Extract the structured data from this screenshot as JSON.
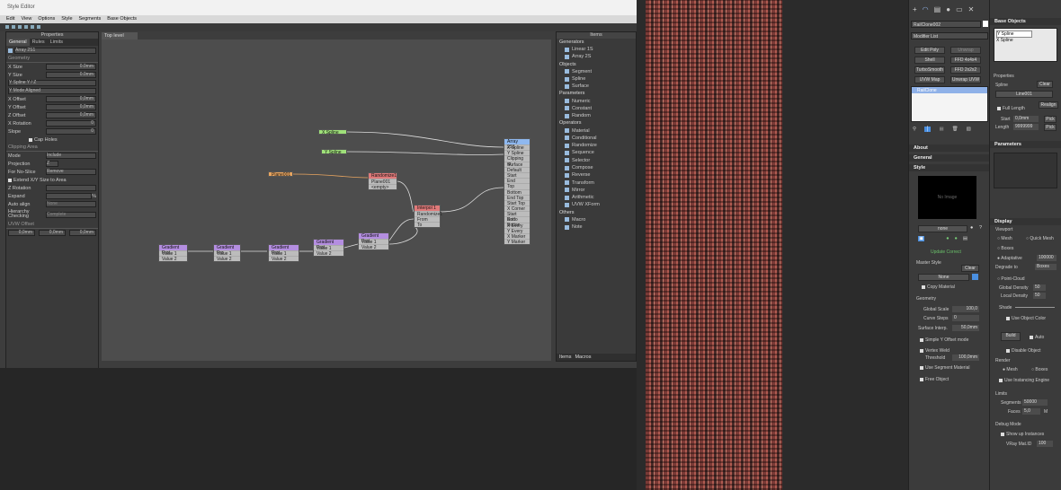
{
  "window": {
    "title": "Style Editor"
  },
  "menu": [
    "Edit",
    "View",
    "Options",
    "Style",
    "Segments",
    "Base Objects"
  ],
  "properties": {
    "title": "Properties",
    "tabs": [
      "General",
      "Rules",
      "Limits"
    ],
    "object_name": "Array 2S1",
    "geometry_label": "Geometry",
    "rows": [
      {
        "label": "X Size",
        "value": "0.0mm"
      },
      {
        "label": "Y Size",
        "value": "0.0mm"
      },
      {
        "label": "Y Spline Y / Z",
        "value": ""
      },
      {
        "label": "Y Mode Aligned",
        "value": ""
      },
      {
        "label": "X Offset",
        "value": "0,0mm"
      },
      {
        "label": "Y Offset",
        "value": "0,0mm"
      },
      {
        "label": "Z Offset",
        "value": "0,0mm"
      },
      {
        "label": "X Rotation",
        "value": "0"
      },
      {
        "label": "Slope",
        "value": "0"
      }
    ],
    "cap_holes": "Cap Holes",
    "clipping_label": "Clipping Area",
    "mode_label": "Mode",
    "mode_value": "Include",
    "projection_label": "Projection",
    "projection_value": "Z",
    "for_no_slice_label": "For No-Slice",
    "for_no_slice_value": "Remove",
    "extend_label": "Extend X/Y Size to Area",
    "z_rotation_label": "Z Rotation",
    "expand_label": "Expand",
    "expand_unit": "%",
    "auto_align_label": "Auto align",
    "auto_align_value": "None",
    "hierarchy_label": "Hierarchy Checking",
    "hierarchy_value": "Complete",
    "uvw_label": "UVW Offset",
    "uvw_values": [
      "0,0mm",
      "0,0mm",
      "0,0mm"
    ]
  },
  "canvas": {
    "breadcrumb": "Top level",
    "nodes": {
      "xspline": "X Spline",
      "yspline": "Y Spline",
      "plane": "Plane001",
      "randomize": "Randomize1",
      "randomize_rows": [
        "Plane001",
        "<empty>"
      ],
      "interpolate": "Interpol 1",
      "interpolate_rows": [
        "Randomize1",
        "From",
        "To"
      ],
      "array": "Array 2S1",
      "array_rows": [
        "X Spline",
        "Y Spline",
        "Clipping ar",
        "Surface",
        "Default",
        "Start",
        "End",
        "Top",
        "Bottom",
        "End Top",
        "Start Top",
        "X Corner",
        "Start Botto",
        "End Botton",
        "X Every",
        "Y Every",
        "X Marker",
        "Y Marker"
      ],
      "grad1": "Gradient Prot",
      "grad2": "Gradient Pro",
      "grad3": "Gradient Prot",
      "grad4": "Gradient Prot",
      "grad5": "Gradient Prot",
      "value1": "Value 1",
      "value2": "Value 2"
    }
  },
  "items": {
    "title": "Items",
    "groups": [
      {
        "name": "Generators",
        "items": [
          "Linear 1S",
          "Array 2S"
        ]
      },
      {
        "name": "Objects",
        "items": [
          "Segment",
          "Spline",
          "Surface"
        ]
      },
      {
        "name": "Parameters",
        "items": [
          "Numeric",
          "Constant",
          "Random"
        ]
      },
      {
        "name": "Operators",
        "items": [
          "Material",
          "Conditional",
          "Randomize",
          "Sequence",
          "Selector",
          "Compose",
          "Reverse",
          "Transform",
          "Mirror",
          "Arithmetic",
          "UVW XForm"
        ]
      },
      {
        "name": "Others",
        "items": [
          "Macro",
          "Note"
        ]
      }
    ],
    "bottom_tabs": [
      "Items",
      "Macros"
    ]
  },
  "modifier": {
    "object_name": "RailClone002",
    "modifier_list": "Modifier List",
    "buttons": [
      "Edit Poly",
      "Unwrap",
      "Shell",
      "FFD 4x4x4",
      "TurboSmooth",
      "FFD 2x2x2",
      "UVW Map",
      "Unwrap UVW"
    ],
    "stack_item": "RailClone",
    "about": "About",
    "general": "General",
    "style": "Style",
    "no_image": "No Image",
    "style_name": "none",
    "style_status": "Update Correct",
    "master_style": "Master Style",
    "clear": "Clear",
    "master_none": "None",
    "copy_material": "Copy Material",
    "geometry": "Geometry",
    "global_scale_label": "Global Scale",
    "global_scale": "100,0",
    "curve_steps_label": "Curve Steps",
    "curve_steps": "0",
    "surface_interp_label": "Surface Interp.",
    "surface_interp": "50,0mm",
    "simple_y_offset": "Simple Y Offset mode",
    "vertex_weld": "Vertex Weld",
    "threshold_label": "Threshold",
    "threshold": "100,0mm",
    "use_segment_material": "Use Segment Material",
    "free_object": "Free Object"
  },
  "base": {
    "title": "Base Objects",
    "items": [
      "Y Spline",
      "X Spline"
    ],
    "properties": "Properties",
    "spline_label": "Spline",
    "spline_clear": "Clear",
    "spline_name": "Line001",
    "full_length": "Full Length",
    "realign": "Realign",
    "start_label": "Start",
    "start_value": "0,0mm",
    "pick": "Pick",
    "length_label": "Length",
    "length_value": "9999999",
    "parameters": "Parameters",
    "display": "Display",
    "viewport": "Viewport",
    "mesh": "Mesh",
    "quick_mesh": "Quick Mesh",
    "boxes": "Boxes",
    "adaptative": "Adaptative",
    "adaptative_value": "100000",
    "degrade_to_label": "Degrade to",
    "degrade_to": "Boxes",
    "pointcloud": "Point-Cloud",
    "global_density_label": "Global Density",
    "global_density": "50",
    "local_density_label": "Local Density",
    "local_density": "50",
    "shade": "Shade",
    "use_object_color": "Use Object Color",
    "build": "Build",
    "auto": "Auto",
    "disable_object": "Disable Object",
    "render": "Render",
    "render_mesh": "Mesh",
    "render_boxes": "Boxes",
    "use_instancing": "Use Instancing Engine",
    "limits": "Limits",
    "segments_label": "Segments",
    "segments": "50000",
    "faces_label": "Faces",
    "faces": "5,0",
    "faces_unit": "M",
    "debug": "Debug Mode",
    "show_instances": "Show up Instances",
    "vray_label": "VRay Mat.ID",
    "vray": "100"
  },
  "colors": {
    "node_green": "#9fe07a",
    "node_purple": "#b48ee0",
    "node_red": "#e07a7a",
    "node_orange": "#e8a560",
    "node_blue": "#8fb8ef",
    "stack_blue": "#8fb1e8"
  }
}
